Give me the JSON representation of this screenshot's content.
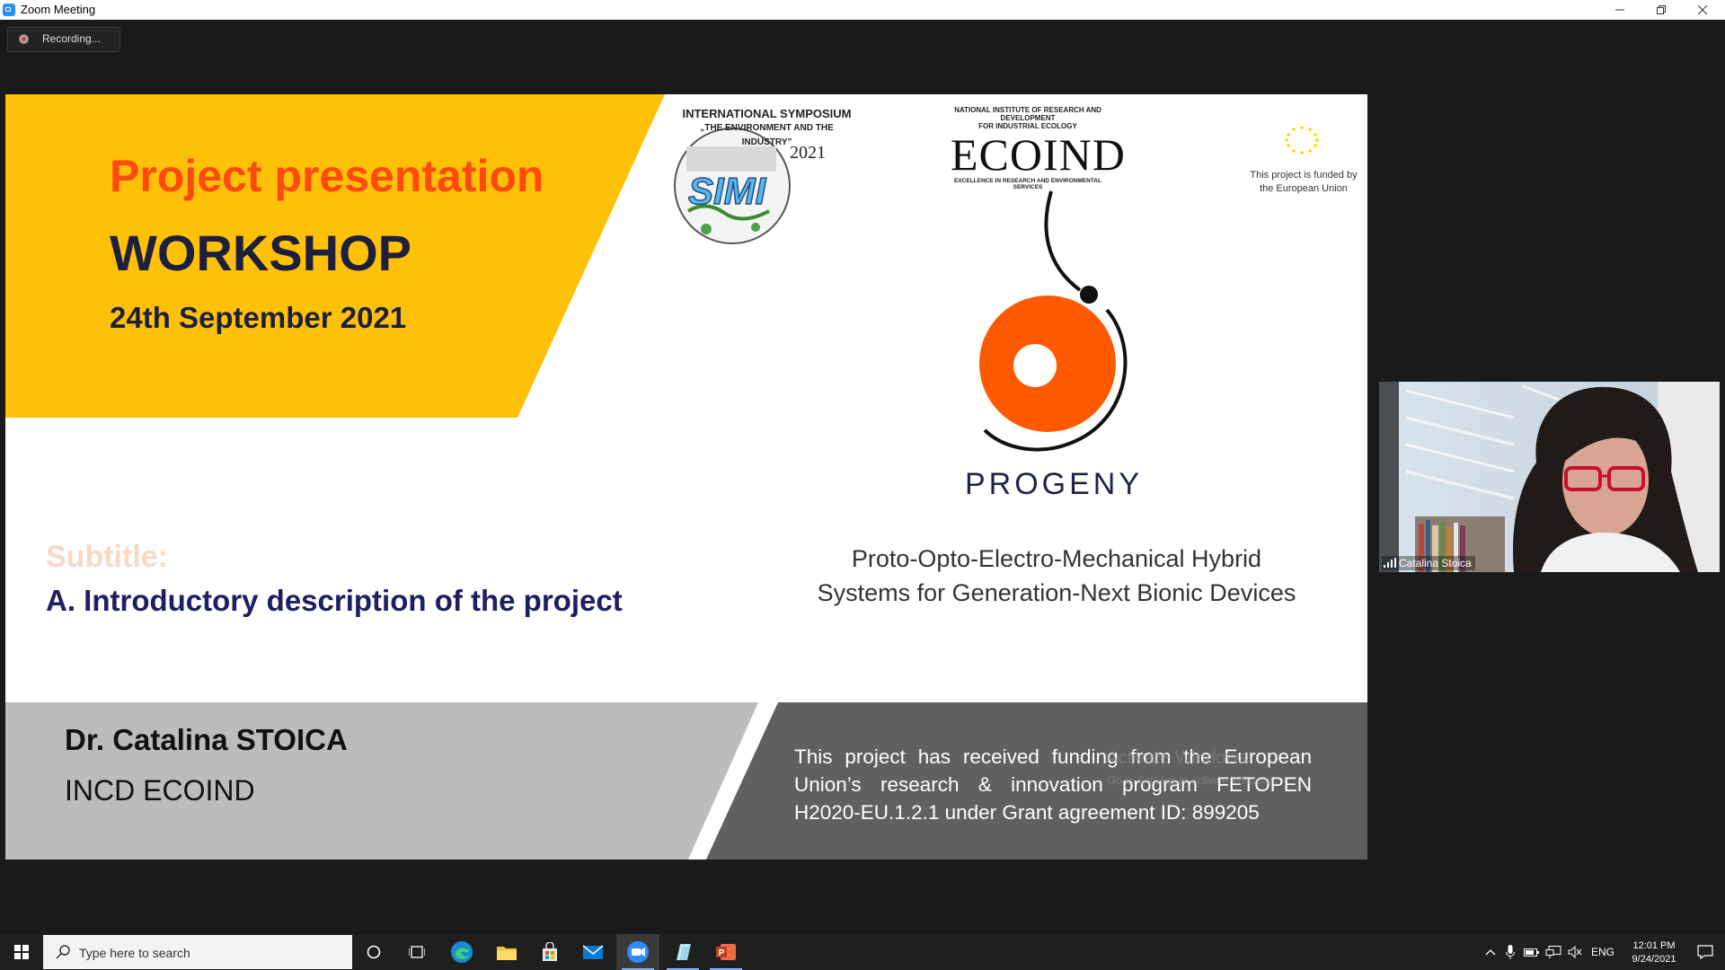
{
  "window": {
    "title": "Zoom Meeting"
  },
  "recording": {
    "label": "Recording..."
  },
  "slide": {
    "title": "Project presentation",
    "event": "WORKSHOP",
    "date": "24th September 2021",
    "subtitle_label": "Subtitle:",
    "subtitle": "A. Introductory description of the project",
    "presenter": "Dr. Catalina STOICA",
    "institution": "INCD ECOIND",
    "funding": "This project has received funding from the European Union’s research & innovation program FETOPEN H2020-EU.1.2.1 under Grant agreement ID: 899205",
    "project_name": "PROGENY",
    "project_fullname_line1": "Proto-Opto-Electro-Mechanical Hybrid",
    "project_fullname_line2": "Systems for Generation-Next Bionic Devices",
    "simi": {
      "line1": "INTERNATIONAL  SYMPOSIUM",
      "line2": "„THE ENVIRONMENT AND THE INDUSTRY”",
      "year": "2021",
      "logo_text": "SIMI"
    },
    "ecoind": {
      "top_line1": "NATIONAL INSTITUTE OF RESEARCH AND DEVELOPMENT",
      "top_line2": "FOR INDUSTRIAL ECOLOGY",
      "word": "ECOIND",
      "tagline": "EXCELLENCE IN RESEARCH AND ENVIRONMENTAL SERVICES"
    },
    "eu": {
      "line1": "This project is funded by",
      "line2": "the European Union"
    },
    "watermark": {
      "line1": "Activate Windows",
      "line2": "Go to Settings to activate Windows."
    },
    "colors": {
      "accent_yellow": "#ffc107",
      "title_orange": "#ff4a0e",
      "navy": "#1d1f3d",
      "orange_logo": "#ff5a00",
      "gray_light": "#bcbcbc",
      "gray_dark": "#606060"
    }
  },
  "video": {
    "participant": "Catalina Stoica"
  },
  "taskbar": {
    "search_placeholder": "Type here to search",
    "language": "ENG",
    "time": "12:01 PM",
    "date": "9/24/2021",
    "apps": [
      "windows-icon",
      "cortana-icon",
      "task-view-icon",
      "edge-icon",
      "file-explorer-icon",
      "store-icon",
      "mail-icon",
      "zoom-icon",
      "notepad-icon",
      "powerpoint-icon"
    ]
  }
}
